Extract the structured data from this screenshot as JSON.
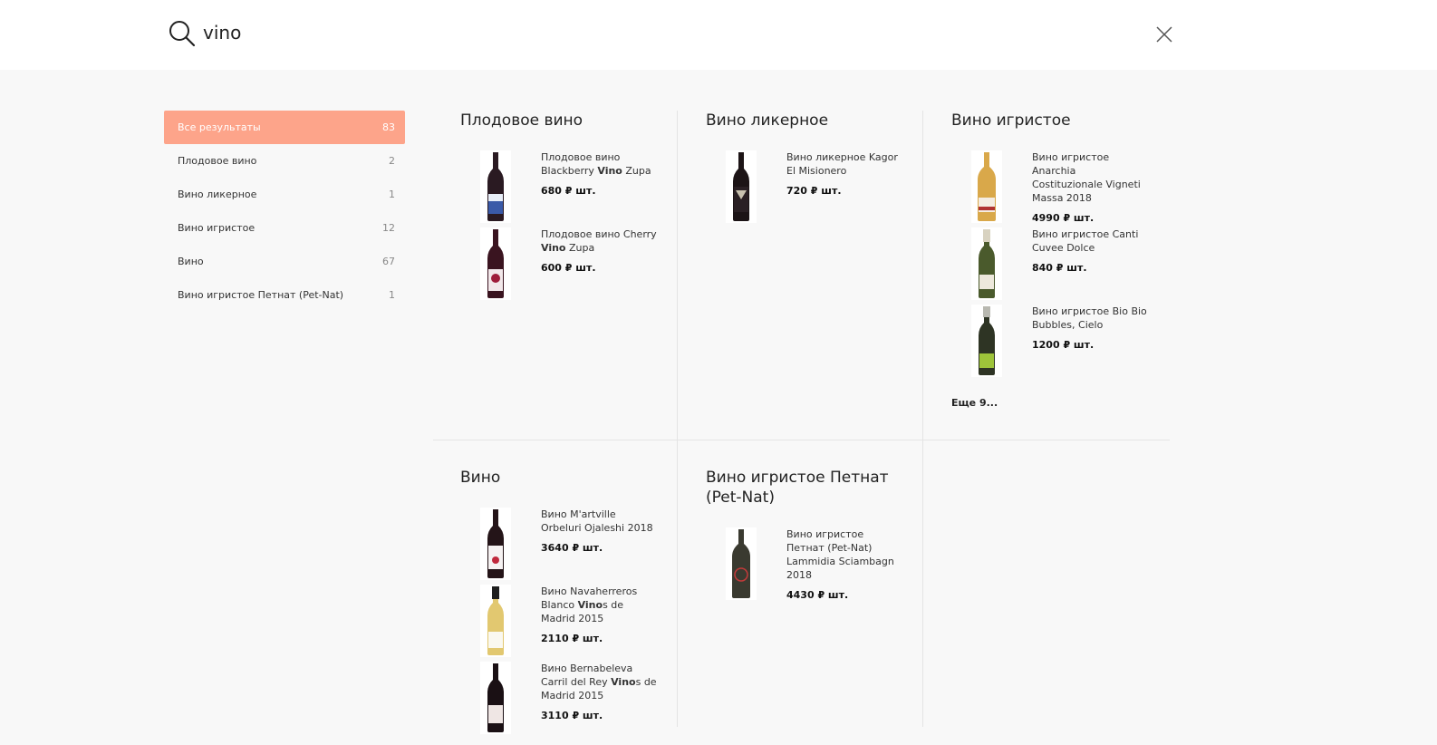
{
  "search": {
    "query": "vino"
  },
  "sidebar": {
    "items": [
      {
        "label": "Все результаты",
        "count": "83"
      },
      {
        "label": "Плодовое вино",
        "count": "2"
      },
      {
        "label": "Вино ликерное",
        "count": "1"
      },
      {
        "label": "Вино игристое",
        "count": "12"
      },
      {
        "label": "Вино",
        "count": "67"
      },
      {
        "label": "Вино игристое Петнат (Pet-Nat)",
        "count": "1"
      }
    ]
  },
  "groups": [
    {
      "title": "Плодовое вино",
      "products": [
        {
          "name_before": "Плодовое вино Blackberry ",
          "name_bold": "Vino",
          "name_after": " Zupa",
          "price": "680 ₽ шт."
        },
        {
          "name_before": "Плодовое вино Cherry ",
          "name_bold": "Vino",
          "name_after": " Zupa",
          "price": "600 ₽ шт."
        }
      ]
    },
    {
      "title": "Вино ликерное",
      "products": [
        {
          "name_before": "Вино ликерное Kagor El Misionero",
          "name_bold": "",
          "name_after": "",
          "price": "720 ₽ шт."
        }
      ]
    },
    {
      "title": "Вино игристое",
      "products": [
        {
          "name_before": "Вино игристое Anarchia Costituzionale Vigneti Massa 2018",
          "name_bold": "",
          "name_after": "",
          "price": "4990 ₽ шт."
        },
        {
          "name_before": "Вино игристое Canti Cuvee Dolce",
          "name_bold": "",
          "name_after": "",
          "price": "840 ₽ шт."
        },
        {
          "name_before": "Вино игристое Bio Bio Bubbles, Cielo",
          "name_bold": "",
          "name_after": "",
          "price": "1200 ₽ шт."
        }
      ],
      "more": "Еще 9..."
    },
    {
      "title": "Вино",
      "products": [
        {
          "name_before": "Вино M'artville Orbeluri Ojaleshi 2018",
          "name_bold": "",
          "name_after": "",
          "price": "3640 ₽ шт."
        },
        {
          "name_before": "Вино Navaherreros Blanco ",
          "name_bold": "Vino",
          "name_after": "s de Madrid 2015",
          "price": "2110 ₽ шт."
        },
        {
          "name_before": "Вино Bernabeleva Carril del Rey ",
          "name_bold": "Vino",
          "name_after": "s de Madrid 2015",
          "price": "3110 ₽ шт."
        }
      ]
    },
    {
      "title": "Вино игристое Петнат (Pet-Nat)",
      "products": [
        {
          "name_before": "Вино игристое Петнат (Pet-Nat) Lammidia Sciambagn 2018",
          "name_bold": "",
          "name_after": "",
          "price": "4430 ₽ шт."
        }
      ]
    }
  ],
  "colors": {
    "accent": "#fda48a",
    "background": "#f8f8f8",
    "divider": "#e4e4e4"
  }
}
